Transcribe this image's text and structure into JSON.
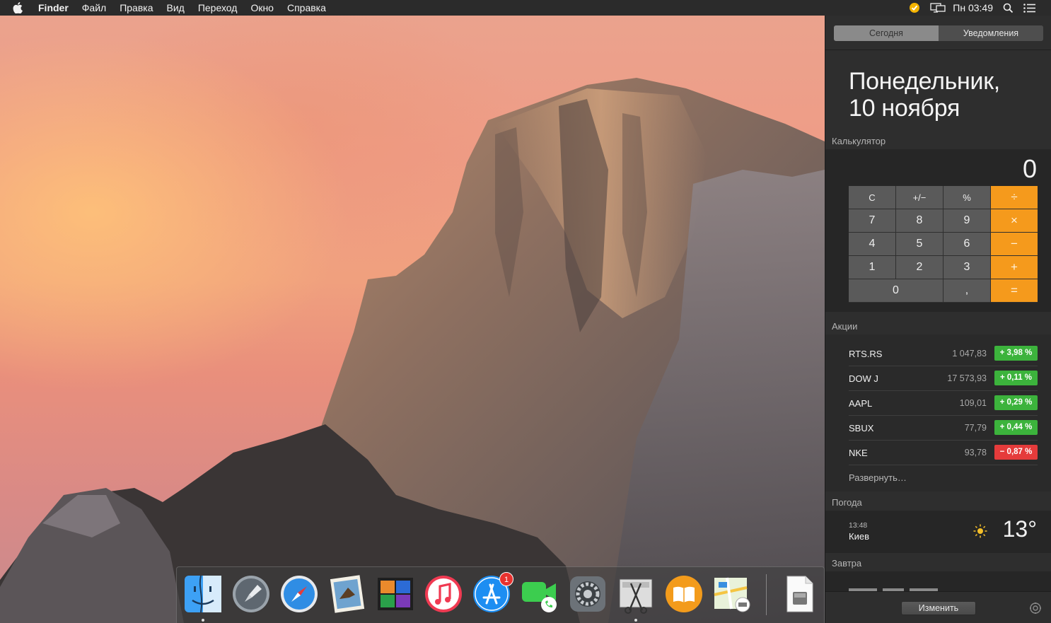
{
  "menubar": {
    "app_name": "Finder",
    "menus": [
      "Файл",
      "Правка",
      "Вид",
      "Переход",
      "Окно",
      "Справка"
    ],
    "status": {
      "clock": "Пн 03:49"
    },
    "icons": [
      "apple-logo-icon",
      "norton-check-icon",
      "displays-icon",
      "spotlight-search-icon",
      "notification-center-icon"
    ]
  },
  "notification_center": {
    "tabs": [
      "Сегодня",
      "Уведомления"
    ],
    "active_tab": "Сегодня",
    "date_line1": "Понедельник,",
    "date_line2": "10 ноября",
    "calculator": {
      "title": "Калькулятор",
      "display": "0",
      "keys": [
        "C",
        "+/−",
        "%",
        "÷",
        "7",
        "8",
        "9",
        "×",
        "4",
        "5",
        "6",
        "−",
        "1",
        "2",
        "3",
        "+",
        "0",
        ",",
        "="
      ]
    },
    "stocks": {
      "title": "Акции",
      "rows": [
        {
          "symbol": "RTS.RS",
          "price": "1 047,83",
          "change": "+ 3,98 %",
          "direction": "up"
        },
        {
          "symbol": "DOW J",
          "price": "17 573,93",
          "change": "+ 0,11 %",
          "direction": "up"
        },
        {
          "symbol": "AAPL",
          "price": "109,01",
          "change": "+ 0,29 %",
          "direction": "up"
        },
        {
          "symbol": "SBUX",
          "price": "77,79",
          "change": "+ 0,44 %",
          "direction": "up"
        },
        {
          "symbol": "NKE",
          "price": "93,78",
          "change": "− 0,87 %",
          "direction": "down"
        }
      ],
      "expand_label": "Развернуть…"
    },
    "weather": {
      "title": "Погода",
      "time": "13:48",
      "city": "Киев",
      "temperature": "13°",
      "icon": "sun-icon"
    },
    "tomorrow": {
      "title": "Завтра"
    },
    "edit_button": "Изменить"
  },
  "dock": {
    "apps": [
      {
        "name": "Finder",
        "icon": "finder-icon",
        "running": true
      },
      {
        "name": "Launchpad",
        "icon": "launchpad-icon",
        "running": false
      },
      {
        "name": "Safari",
        "icon": "safari-icon",
        "running": false
      },
      {
        "name": "Mail",
        "icon": "mail-icon",
        "running": false
      },
      {
        "name": "Photo Booth",
        "icon": "photo-booth-icon",
        "running": false
      },
      {
        "name": "iTunes",
        "icon": "itunes-icon",
        "running": false
      },
      {
        "name": "App Store",
        "icon": "app-store-icon",
        "running": false,
        "badge": "1"
      },
      {
        "name": "FaceTime",
        "icon": "facetime-icon",
        "running": false
      },
      {
        "name": "System Preferences",
        "icon": "system-preferences-icon",
        "running": false
      },
      {
        "name": "Screenshot Editor",
        "icon": "scissors-icon",
        "running": true
      },
      {
        "name": "iBooks",
        "icon": "ibooks-icon",
        "running": false
      },
      {
        "name": "Maps",
        "icon": "maps-icon",
        "running": false
      },
      {
        "name": "Documents",
        "icon": "document-icon",
        "running": false
      }
    ]
  },
  "colors": {
    "accent_orange": "#f59a1c",
    "stock_up": "#3cb33c",
    "stock_down": "#e53b3b",
    "panel_bg": "#2e2e2e"
  }
}
